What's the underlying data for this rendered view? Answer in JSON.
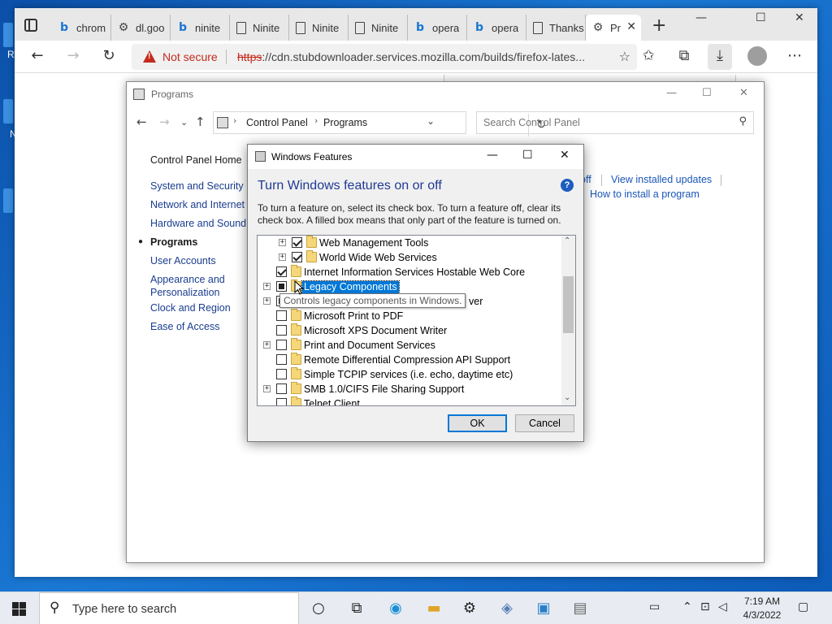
{
  "browser": {
    "tabs": [
      {
        "label": "chrom",
        "icon": "bing-icon"
      },
      {
        "label": "dl.goo",
        "icon": "gear-doc-icon"
      },
      {
        "label": "ninite",
        "icon": "bing-icon"
      },
      {
        "label": "Ninite",
        "icon": "document-icon"
      },
      {
        "label": "Ninite",
        "icon": "document-icon"
      },
      {
        "label": "Ninite",
        "icon": "document-icon"
      },
      {
        "label": "opera",
        "icon": "bing-icon"
      },
      {
        "label": "opera",
        "icon": "bing-icon"
      },
      {
        "label": "Thanks",
        "icon": "document-icon"
      },
      {
        "label": "Pr",
        "icon": "gear-doc-icon",
        "active": true
      }
    ],
    "security_label": "Not secure",
    "url_protocol": "https",
    "url_rest": "://cdn.stubdownloader.services.mozilla.com/builds/firefox-lates...",
    "accent_warning": "#c42b1c"
  },
  "control_panel": {
    "title": "Programs",
    "breadcrumb": [
      "Control Panel",
      "Programs"
    ],
    "search_placeholder": "Search Control Panel",
    "sidebar": {
      "home": "Control Panel Home",
      "items": [
        "System and Security",
        "Network and Internet",
        "Hardware and Sound",
        "Programs",
        "User Accounts",
        "Appearance and Personalization",
        "Clock and Region",
        "Ease of Access"
      ],
      "active_item": "Programs"
    },
    "links": {
      "frag_off": "off",
      "view_installed_updates": "View installed updates",
      "how_to_install": "How to install a program"
    }
  },
  "windows_features": {
    "title": "Windows Features",
    "heading": "Turn Windows features on or off",
    "description": "To turn a feature on, select its check box. To turn a feature off, clear its check box. A filled box means that only part of the feature is turned on.",
    "features": [
      {
        "label": "Web Management Tools",
        "state": "checked",
        "level": 1,
        "expandable": true
      },
      {
        "label": "World Wide Web Services",
        "state": "checked",
        "level": 1,
        "expandable": true
      },
      {
        "label": "Internet Information Services Hostable Web Core",
        "state": "checked",
        "level": 0,
        "expandable": false
      },
      {
        "label": "Legacy Components",
        "state": "partial",
        "level": 0,
        "expandable": true,
        "selected": true
      },
      {
        "label": "ver",
        "state": "partial",
        "level": 0,
        "expandable": true
      },
      {
        "label": "Microsoft Print to PDF",
        "state": "unchecked",
        "level": 0,
        "expandable": false
      },
      {
        "label": "Microsoft XPS Document Writer",
        "state": "unchecked",
        "level": 0,
        "expandable": false
      },
      {
        "label": "Print and Document Services",
        "state": "unchecked",
        "level": 0,
        "expandable": true
      },
      {
        "label": "Remote Differential Compression API Support",
        "state": "unchecked",
        "level": 0,
        "expandable": false
      },
      {
        "label": "Simple TCPIP services (i.e. echo, daytime etc)",
        "state": "unchecked",
        "level": 0,
        "expandable": false
      },
      {
        "label": "SMB 1.0/CIFS File Sharing Support",
        "state": "unchecked",
        "level": 0,
        "expandable": true
      },
      {
        "label": "Telnet Client",
        "state": "unchecked",
        "level": 0,
        "expandable": false
      }
    ],
    "tooltip": "Controls legacy components in Windows.",
    "ok_label": "OK",
    "cancel_label": "Cancel",
    "accent": "#0078d7"
  },
  "taskbar": {
    "search_placeholder": "Type here to search",
    "time": "7:19 AM",
    "date": "4/3/2022"
  },
  "desktop": {
    "edge_letter_1": "R",
    "edge_letter_2": "N"
  }
}
